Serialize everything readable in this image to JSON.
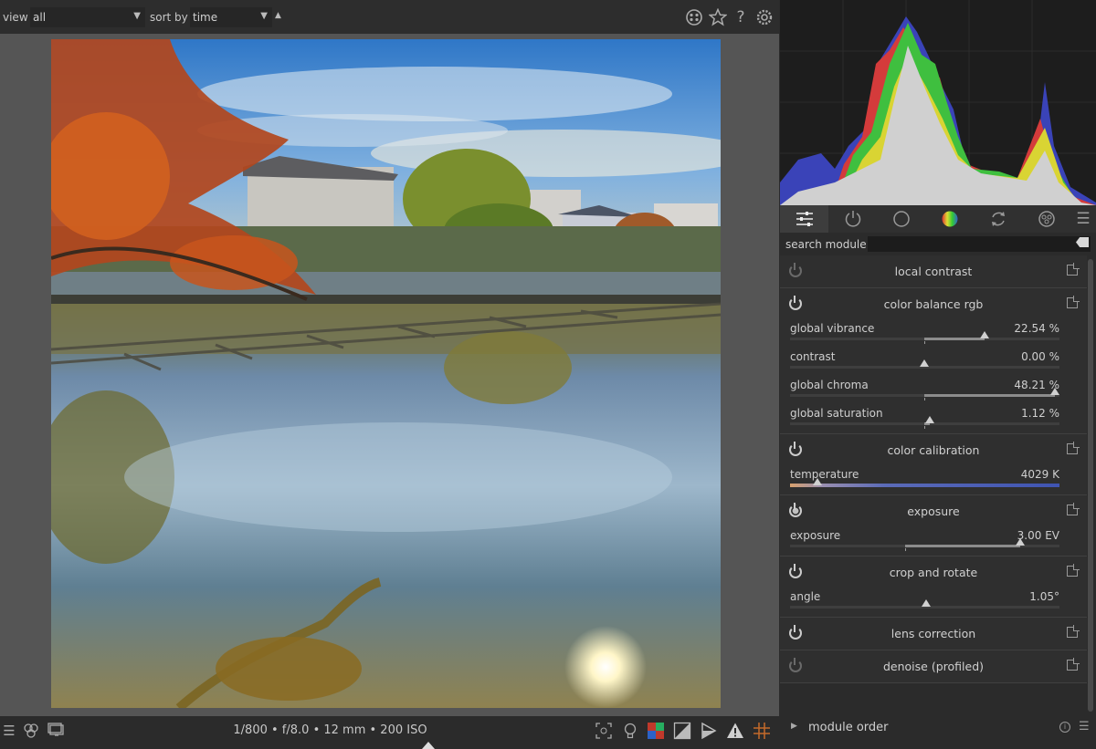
{
  "topbar": {
    "view_label": "view",
    "view_value": "all",
    "sort_label": "sort by",
    "sort_value": "time",
    "icons": [
      "grouping-icon",
      "star-icon",
      "help-icon",
      "gear-icon"
    ]
  },
  "bottombar": {
    "exif_info": "1/800 • f/8.0 • 12 mm • 200 ISO",
    "left_icons": [
      "panels-menu-icon",
      "color-assessment-icon",
      "display-profile-icon"
    ],
    "right_icons": [
      "focus-peaking-icon",
      "bulb-icon",
      "color-picker-icon",
      "overexposed-icon",
      "softproof-icon",
      "gamut-check-icon",
      "guides-icon"
    ]
  },
  "module_groups": {
    "tabs": [
      "quick-access-icon",
      "active-modules-icon",
      "base-modules-icon",
      "color-modules-icon",
      "correct-modules-icon",
      "effect-modules-icon",
      "hamburger-icon"
    ]
  },
  "search": {
    "label": "search module",
    "placeholder": ""
  },
  "modules": [
    {
      "title": "local contrast",
      "enabled": false
    },
    {
      "title": "color balance rgb",
      "enabled": true,
      "sliders": [
        {
          "label": "global vibrance",
          "value": "22.54 %"
        },
        {
          "label": "contrast",
          "value": "0.00 %"
        },
        {
          "label": "global chroma",
          "value": "48.21 %"
        },
        {
          "label": "global saturation",
          "value": "1.12 %"
        }
      ]
    },
    {
      "title": "color calibration",
      "enabled": true,
      "sliders": [
        {
          "label": "temperature",
          "value": "4029 K"
        }
      ]
    },
    {
      "title": "exposure",
      "enabled": true,
      "sliders": [
        {
          "label": "exposure",
          "value": "3.00 EV"
        }
      ]
    },
    {
      "title": "crop and rotate",
      "enabled": true,
      "sliders": [
        {
          "label": "angle",
          "value": "1.05°"
        }
      ]
    },
    {
      "title": "lens correction",
      "enabled": true
    },
    {
      "title": "denoise (profiled)",
      "enabled": false
    }
  ],
  "module_order": {
    "label": "module order"
  },
  "colors": {
    "panel_bg": "#2b2b2b",
    "center_bg": "#555555",
    "accent_temp": "#3f54b2"
  }
}
